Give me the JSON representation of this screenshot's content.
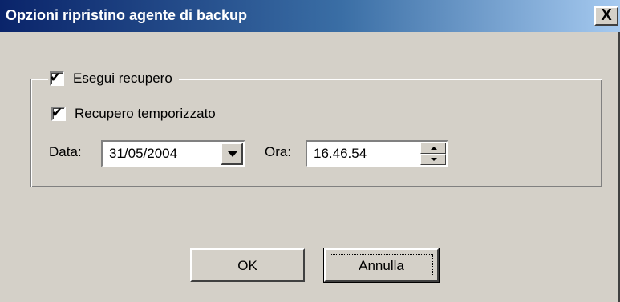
{
  "window": {
    "title": "Opzioni ripristino agente di backup",
    "close_label": "X"
  },
  "group": {
    "perform_recovery": {
      "label": "Esegui recupero",
      "checked": true
    },
    "timed_recovery": {
      "label": "Recupero temporizzato",
      "checked": true
    }
  },
  "date": {
    "label": "Data:",
    "value": "31/05/2004"
  },
  "time": {
    "label": "Ora:",
    "value": "16.46.54"
  },
  "buttons": {
    "ok": "OK",
    "cancel": "Annulla"
  },
  "icons": {
    "check": "check-icon",
    "dropdown": "chevron-down-icon",
    "spin_up": "spin-up-icon",
    "spin_down": "spin-down-icon",
    "close": "close-icon"
  },
  "colors": {
    "title_start": "#0a246a",
    "title_end": "#a6caf0",
    "face": "#d4d0c8"
  }
}
